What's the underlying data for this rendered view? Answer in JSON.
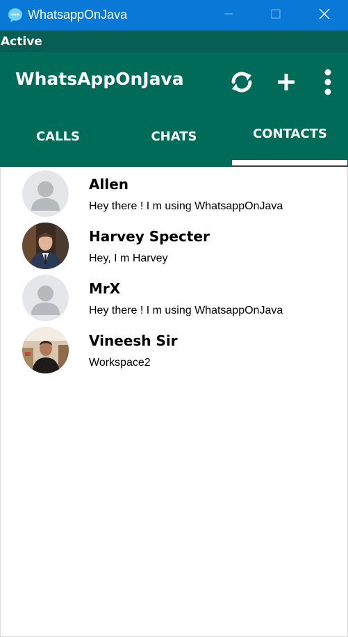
{
  "window": {
    "title": "WhatsappOnJava",
    "icon": "chat-bubble-icon",
    "controls": [
      "minimize-icon",
      "maximize-icon",
      "close-icon"
    ]
  },
  "status": {
    "text": "Active"
  },
  "header": {
    "app_name": "WhatsAppOnJava",
    "actions": [
      "refresh-icon",
      "plus-icon",
      "more-vertical-icon"
    ]
  },
  "tabs": [
    {
      "label": "CALLS",
      "selected": false
    },
    {
      "label": "CHATS",
      "selected": false
    },
    {
      "label": "CONTACTS",
      "selected": true
    }
  ],
  "contacts": [
    {
      "name": "Allen",
      "about": "Hey there ! I m using WhatsappOnJava",
      "avatar": "default-avatar-icon"
    },
    {
      "name": "Harvey Specter",
      "about": "Hey, I m Harvey",
      "avatar": "profile-photo"
    },
    {
      "name": "MrX",
      "about": "Hey there ! I m using WhatsappOnJava",
      "avatar": "default-avatar-icon"
    },
    {
      "name": "Vineesh Sir",
      "about": "Workspace2",
      "avatar": "profile-photo"
    }
  ],
  "colors": {
    "titlebar": "#0a78d7",
    "status_bar": "#075e54",
    "header": "#006b58",
    "text_light": "#ffffff"
  }
}
